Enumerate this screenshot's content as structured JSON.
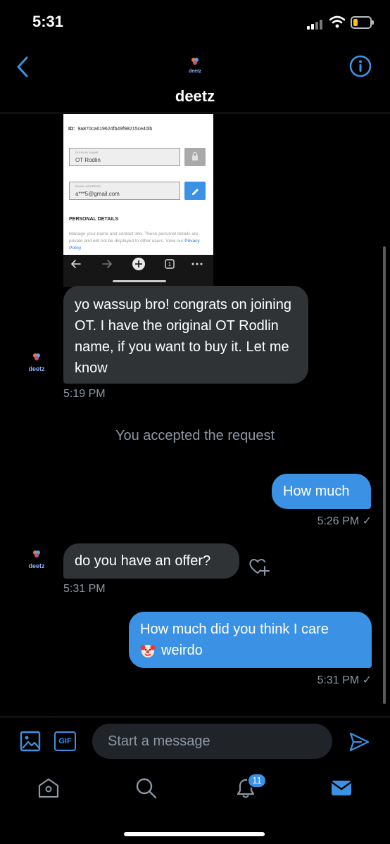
{
  "status_bar": {
    "time": "5:31",
    "battery_color": "#f5c518",
    "icons": [
      "signal-icon",
      "wifi-icon",
      "battery-icon"
    ]
  },
  "header": {
    "title": "deetz",
    "avatar_text": "deetz",
    "back_icon": "chevron-left-icon",
    "info_icon": "info-icon"
  },
  "shared_screenshot": {
    "id_label": "ID:",
    "id_value": "9a870ca619624fb49f98215ce40lb",
    "display_name_label": "DISPLAY NAME",
    "display_name_value": "OT Rodlin",
    "email_label": "EMAIL ADDRESS",
    "email_value": "a***5@gmail.com",
    "section_title": "PERSONAL DETAILS",
    "section_text": "Manage your name and contact info. These personal details are private and will not be displayed to other users. View our",
    "section_link": "Privacy Policy",
    "tab_count": "1"
  },
  "messages": [
    {
      "direction": "incoming",
      "text": "yo wassup bro! congrats on joining OT. I have the original OT Rodlin name, if you want to buy it. Let me know",
      "time": "5:19 PM",
      "sender_avatar": "deetz"
    },
    {
      "direction": "system",
      "text": "You accepted the request"
    },
    {
      "direction": "outgoing",
      "text": "How much",
      "time": "5:26 PM ✓"
    },
    {
      "direction": "incoming",
      "text": "do you have an offer?",
      "time": "5:31 PM",
      "sender_avatar": "deetz"
    },
    {
      "direction": "outgoing",
      "text_line1": "How much did you think I care",
      "emoji": "clown-face",
      "text_line2": "weirdo",
      "time": "5:31 PM ✓"
    }
  ],
  "composer": {
    "placeholder": "Start a message",
    "gif_label": "GIF"
  },
  "tabbar": {
    "notifications_badge": "11",
    "items": [
      "home-icon",
      "search-icon",
      "notifications-icon",
      "messages-icon"
    ]
  },
  "colors": {
    "accent": "#3b92e4",
    "incoming_bubble": "#2f3336",
    "secondary_text": "#8b98a5",
    "background": "#000000"
  }
}
